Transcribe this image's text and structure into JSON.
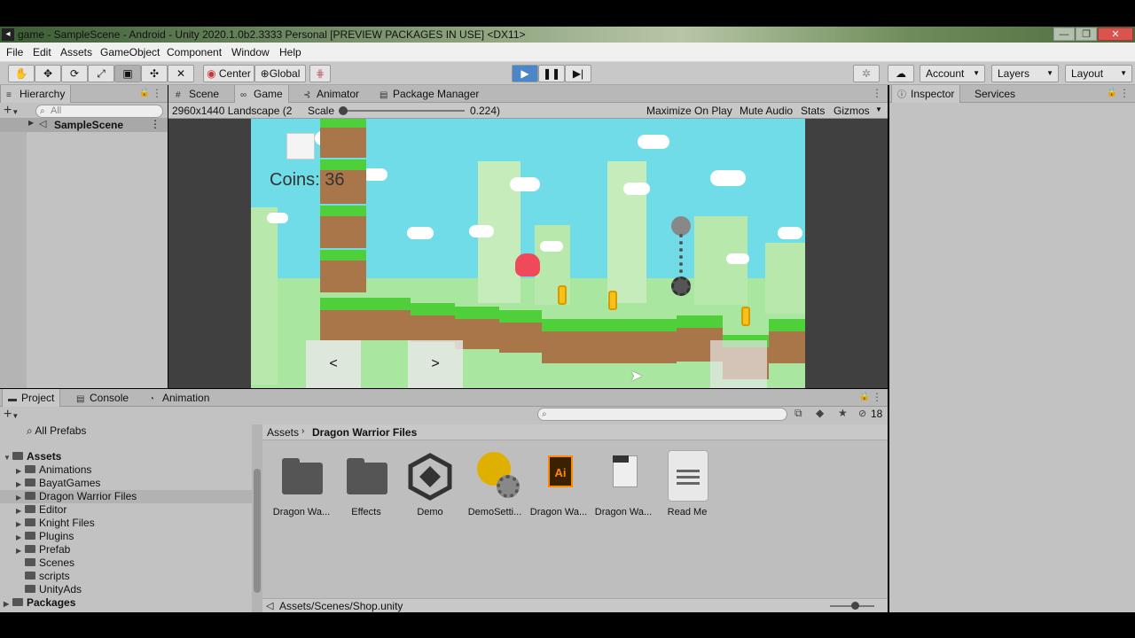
{
  "window": {
    "title": "game - SampleScene - Android - Unity 2020.1.0b2.3333 Personal [PREVIEW PACKAGES IN USE] <DX11>",
    "minimize": "—",
    "maximize": "❐",
    "close": "✕"
  },
  "menu": [
    "File",
    "Edit",
    "Assets",
    "GameObject",
    "Component",
    "Window",
    "Help"
  ],
  "toolbar": {
    "pivot_label": "Center",
    "space_label": "Global",
    "account_label": "Account",
    "layers_label": "Layers",
    "layout_label": "Layout"
  },
  "hierarchy": {
    "tab": "Hierarchy",
    "search_placeholder": "All",
    "scene": "SampleScene"
  },
  "center_tabs": [
    "Scene",
    "Game",
    "Animator",
    "Package Manager"
  ],
  "game_bar": {
    "resolution": "2960x1440 Landscape (2",
    "scale_label": "Scale",
    "scale_value": "0.224)",
    "maximize": "Maximize On Play",
    "mute": "Mute Audio",
    "stats": "Stats",
    "gizmos": "Gizmos"
  },
  "game": {
    "coins": "Coins: 36",
    "left_btn": "<",
    "right_btn": ">"
  },
  "inspector_tabs": [
    "Inspector",
    "Services"
  ],
  "bottom_tabs": [
    "Project",
    "Console",
    "Animation"
  ],
  "project": {
    "favorites": "All Prefabs",
    "root": "Assets",
    "folders": [
      "Animations",
      "BayatGames",
      "Dragon Warrior Files",
      "Editor",
      "Knight Files",
      "Plugins",
      "Prefab",
      "Scenes",
      "scripts",
      "UnityAds"
    ],
    "packages": "Packages",
    "breadcrumb_root": "Assets",
    "breadcrumb_current": "Dragon Warrior Files",
    "hidden_count": "18",
    "assets": [
      {
        "label": "Dragon Wa...",
        "icon": "folder-icon"
      },
      {
        "label": "Effects",
        "icon": "folder-icon"
      },
      {
        "label": "Demo",
        "icon": "unity-icon"
      },
      {
        "label": "DemoSetti...",
        "icon": "settings-asset-icon"
      },
      {
        "label": "Dragon Wa...",
        "icon": "illustrator-file-icon"
      },
      {
        "label": "Dragon Wa...",
        "icon": "eps-file-icon"
      },
      {
        "label": "Read Me",
        "icon": "text-document-icon"
      }
    ],
    "status_path": "Assets/Scenes/Shop.unity"
  },
  "colors": {
    "sky": "#6fdce8",
    "play_active": "#4a86c8",
    "grass": "#4fcf3a",
    "dirt": "#a9764a"
  }
}
